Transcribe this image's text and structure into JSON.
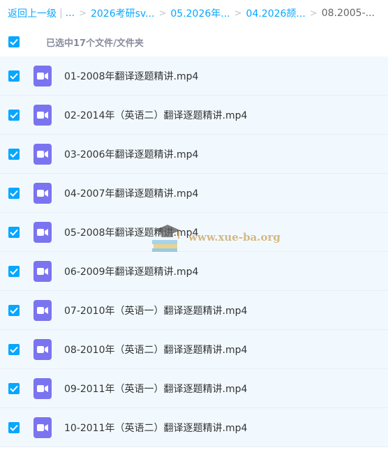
{
  "breadcrumb": {
    "back_label": "返回上一级",
    "divider": "|",
    "ellipsis": "...",
    "separator": ">",
    "items": [
      "2026考研sv...",
      "05.2026年...",
      "04.2026颉...",
      "08.2005-..."
    ]
  },
  "selection": {
    "text": "已选中17个文件/文件夹",
    "checked": true
  },
  "files": [
    {
      "name": "01-2008年翻译逐题精讲.mp4",
      "type": "video-file-icon",
      "checked": true
    },
    {
      "name": "02-2014年（英语二）翻译逐题精讲.mp4",
      "type": "video-file-icon",
      "checked": true
    },
    {
      "name": "03-2006年翻译逐题精讲.mp4",
      "type": "video-file-icon",
      "checked": true
    },
    {
      "name": "04-2007年翻译逐题精讲.mp4",
      "type": "video-file-icon",
      "checked": true
    },
    {
      "name": "05-2008年翻译逐题精讲.mp4",
      "type": "video-file-icon",
      "checked": true
    },
    {
      "name": "06-2009年翻译逐题精讲.mp4",
      "type": "video-file-icon",
      "checked": true
    },
    {
      "name": "07-2010年（英语一）翻译逐题精讲.mp4",
      "type": "video-file-icon",
      "checked": true
    },
    {
      "name": "08-2010年（英语二）翻译逐题精讲.mp4",
      "type": "video-file-icon",
      "checked": true
    },
    {
      "name": "09-2011年（英语一）翻译逐题精讲.mp4",
      "type": "video-file-icon",
      "checked": true
    },
    {
      "name": "10-2011年（英语二）翻译逐题精讲.mp4",
      "type": "video-file-icon",
      "checked": true
    }
  ],
  "watermark": {
    "text": "www.xue-ba.org",
    "icon": "graduation-cap-books-icon"
  },
  "colors": {
    "accent": "#06a7ff",
    "row_background": "#f2f9fe",
    "video_icon": "#7b74f0"
  }
}
